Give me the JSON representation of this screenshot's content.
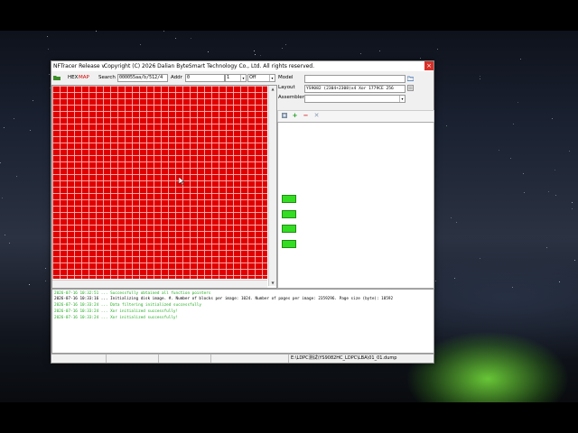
{
  "window": {
    "title": "NFTracer Release v",
    "copyright": "Copyright (C) 2026 Dalian ByteSmart Technology Co., Ltd. All rights reserved.",
    "close_glyph": "×"
  },
  "toolbar": {
    "hex_label": "HEX",
    "map_label": "MAP",
    "search_label": "Search",
    "search_value": "000055aa/b/512/4",
    "addr_label": "Addr",
    "addr_value": "0",
    "count_value": "1",
    "mode_value": "Off",
    "accent_color": "#d00000"
  },
  "right_panel": {
    "model_label": "Model",
    "model_value": "",
    "layout_label": "Layout",
    "layout_value": "YS9082 (2304+2308)x4 Xor 1779CE 256",
    "assembler_label": "Assembler",
    "assembler_value": "",
    "tools": [
      "settings-icon",
      "add-icon",
      "remove-icon",
      "delete-icon"
    ],
    "item_labels": [
      "",
      "",
      "",
      ""
    ]
  },
  "log": {
    "lines": [
      {
        "text": "2026-07-16 10:32:51 ...   Successfully obtained all function pointers",
        "color": "green"
      },
      {
        "text": "2026-07-16 10:33:16 ...   Initializing disk image. #. Number of blocks per image: 1024. Number of pages per image: 2359296. Page size (byte): 18592",
        "color": "black"
      },
      {
        "text": "2026-07-16 10:33:24 ...   Data filtering initialized successfully",
        "color": "green"
      },
      {
        "text": "2026-07-16 10:33:24 ...   Xor initialized successfully!",
        "color": "green"
      },
      {
        "text": "2026-07-16 10:33:24 ...   Xor initialized successfully!",
        "color": "green"
      }
    ]
  },
  "status": {
    "path": "E:\\LDPC测试\\YS9082HC_LDPC\\LBA\\01_01.dump"
  },
  "colors": {
    "map_block": "#e00000",
    "log_success": "#22aa22",
    "close_button": "#d9302a",
    "green_item": "#33dd22"
  }
}
